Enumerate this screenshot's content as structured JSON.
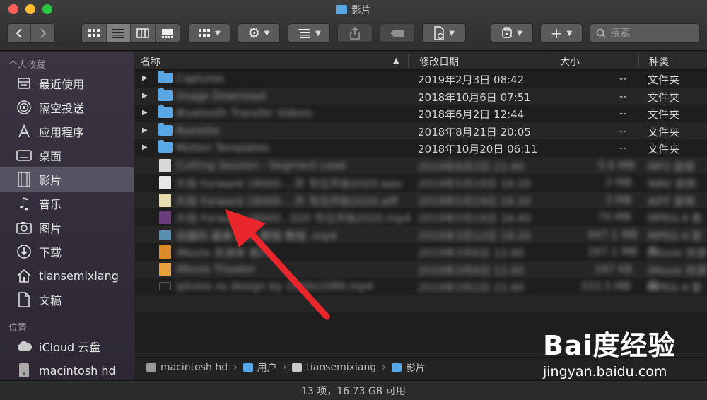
{
  "window": {
    "title": "影片"
  },
  "toolbar": {
    "view_modes": [
      "icon-view",
      "list-view",
      "column-view",
      "gallery-view"
    ],
    "active_view": "list-view",
    "search_placeholder": "搜索"
  },
  "sidebar": {
    "favorites_label": "个人收藏",
    "favorites": [
      {
        "label": "最近使用",
        "icon": "recents-icon"
      },
      {
        "label": "隔空投送",
        "icon": "airdrop-icon"
      },
      {
        "label": "应用程序",
        "icon": "applications-icon"
      },
      {
        "label": "桌面",
        "icon": "desktop-icon"
      },
      {
        "label": "影片",
        "icon": "movies-icon",
        "selected": true
      },
      {
        "label": "音乐",
        "icon": "music-icon"
      },
      {
        "label": "图片",
        "icon": "pictures-icon"
      },
      {
        "label": "下载",
        "icon": "downloads-icon"
      },
      {
        "label": "tiansemixiang",
        "icon": "home-icon"
      },
      {
        "label": "文稿",
        "icon": "documents-icon"
      }
    ],
    "locations_label": "位置",
    "locations": [
      {
        "label": "iCloud 云盘",
        "icon": "icloud-icon"
      },
      {
        "label": "macintosh hd",
        "icon": "disk-icon"
      }
    ]
  },
  "columns": {
    "name": "名称",
    "modified": "修改日期",
    "size": "大小",
    "kind": "种类"
  },
  "folders": [
    {
      "name": "Captures",
      "date": "2019年2月3日 08:42",
      "size": "--",
      "kind": "文件夹"
    },
    {
      "name": "Image Download",
      "date": "2018年10月6日 07:51",
      "size": "--",
      "kind": "文件夹"
    },
    {
      "name": "Bluetooth Transfer Videos",
      "date": "2018年6月2日 12:44",
      "size": "--",
      "kind": "文件夹"
    },
    {
      "name": "Roxlette",
      "date": "2018年8月21日 20:05",
      "size": "--",
      "kind": "文件夹"
    },
    {
      "name": "Motion Templates",
      "date": "2018年10月20日 06:11",
      "size": "--",
      "kind": "文件夹"
    }
  ],
  "files": [
    {
      "name": "Cutting Session - Segment Lead",
      "date": "2019年6月2日 21:40",
      "size": "5.6 MB",
      "kind": "MP3 音频"
    },
    {
      "name": "片段 Forward 18000-...开 号位开始2020.wav",
      "date": "2019年5月19日 16:20",
      "size": "3 MB",
      "kind": "WAV 音频"
    },
    {
      "name": "片段 Forward 18000-...开 号位开始2020.aiff",
      "date": "2019年5月19日 16:20",
      "size": "3 MB",
      "kind": "AIFF 音频"
    },
    {
      "name": "片段 Forward 18000...020 号位开始2020.mp4",
      "date": "2019年5月19日 16:40",
      "size": "70 MB",
      "kind": "MPEG-4 影片"
    },
    {
      "name": "拍摄的 最美 图片 教程 教程 .mp4",
      "date": "2019年3月12日 18:20",
      "size": "447.1 MB",
      "kind": "MPEG-4 影片"
    },
    {
      "name": "iMovie 资源库 图片",
      "date": "2019年3月6日 12:40",
      "size": "167.1 MB",
      "kind": "iMovie 资源库"
    },
    {
      "name": "iMovie Theater",
      "date": "2019年3月6日 12:40",
      "size": "247 KB",
      "kind": "iMovie 资源库"
    },
    {
      "name": "iphone xs design by 1920x1080.mp4",
      "date": "2019年3月2日 21:40",
      "size": "333.3 MB",
      "kind": "MPEG-4 影片"
    }
  ],
  "pathbar": {
    "items": [
      {
        "label": "macintosh hd",
        "icon": "disk-icon"
      },
      {
        "label": "用户",
        "icon": "folder-icon"
      },
      {
        "label": "tiansemixiang",
        "icon": "home-icon"
      },
      {
        "label": "影片",
        "icon": "movies-folder-icon"
      }
    ]
  },
  "status": {
    "text": "13 项，16.73 GB 可用"
  },
  "watermark": {
    "logo": "Bai度经验",
    "url": "jingyan.baidu.com"
  },
  "colors": {
    "sidebar_selected": "#575261",
    "folder_blue": "#5aa7e6",
    "arrow_red": "#e8262c"
  }
}
